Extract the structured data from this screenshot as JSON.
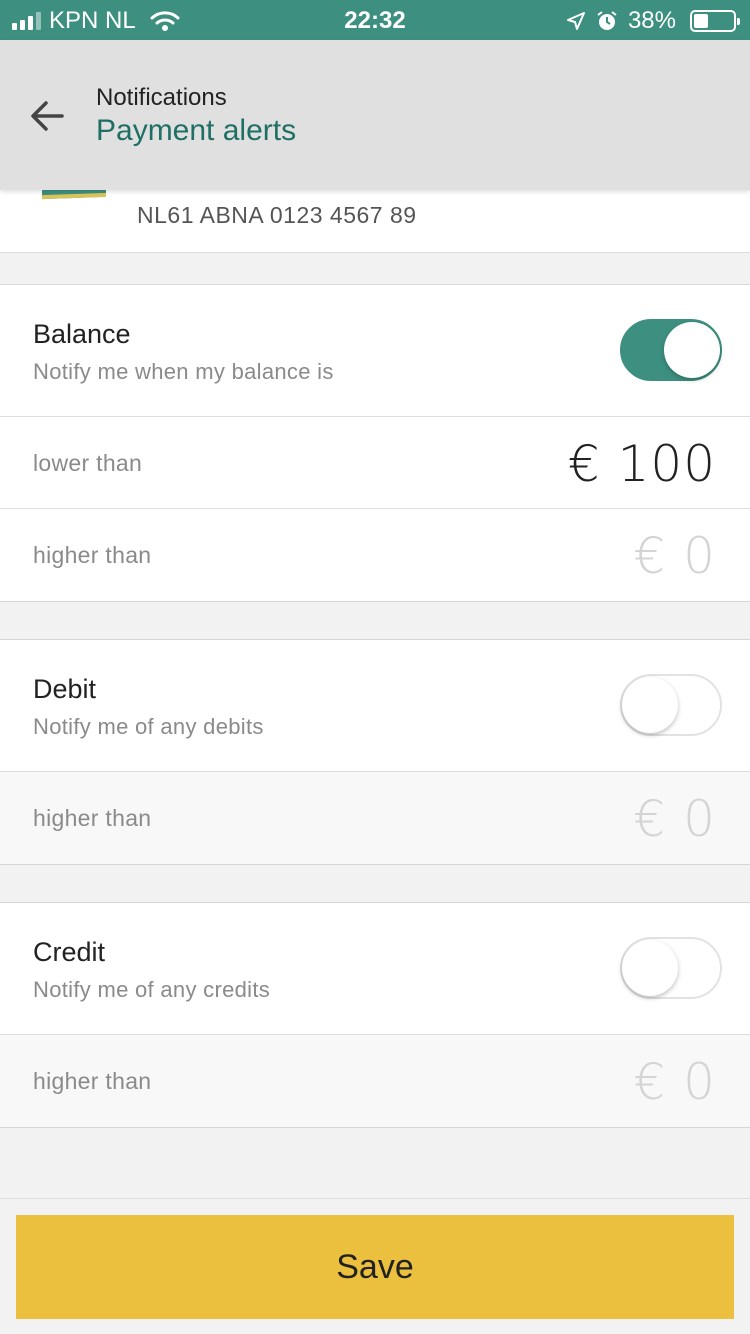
{
  "status_bar": {
    "carrier": "KPN NL",
    "time": "22:32",
    "battery": "38%",
    "battery_level": 0.38
  },
  "header": {
    "subtitle": "Notifications",
    "title": "Payment alerts"
  },
  "account": {
    "number": "NL61 ABNA 0123 4567 89"
  },
  "sections": {
    "balance": {
      "label": "Balance",
      "description": "Notify me when my balance is",
      "enabled": true,
      "lower_label": "lower than",
      "lower_value": "€ 100",
      "higher_label": "higher than",
      "higher_value": "€ 0"
    },
    "debit": {
      "label": "Debit",
      "description": "Notify me of any debits",
      "enabled": false,
      "higher_label": "higher than",
      "higher_value": "€ 0"
    },
    "credit": {
      "label": "Credit",
      "description": "Notify me of any credits",
      "enabled": false,
      "higher_label": "higher than",
      "higher_value": "€ 0"
    }
  },
  "footer": {
    "save_label": "Save"
  },
  "colors": {
    "accent": "#3d9080",
    "title": "#1f6f64",
    "save": "#ebc03f"
  }
}
